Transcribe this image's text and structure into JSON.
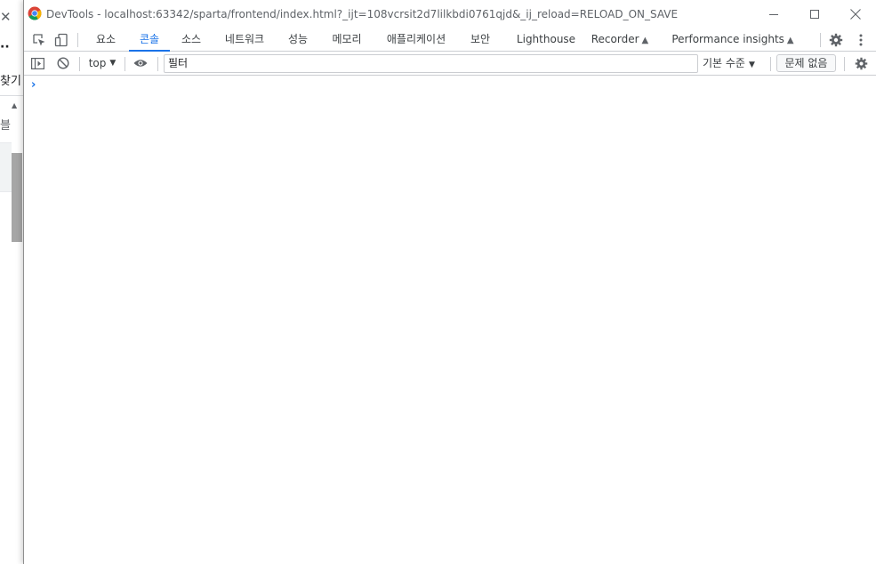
{
  "background_window": {
    "close_glyph": "✕",
    "dots": "··",
    "text_1": "찾기",
    "text_2": "블"
  },
  "window": {
    "title": "DevTools - localhost:63342/sparta/frontend/index.html?_ijt=108vcrsit2d7lilkbdi0761qjd&_ij_reload=RELOAD_ON_SAVE",
    "app_icon": "chrome-icon"
  },
  "tabs": [
    {
      "label": "요소",
      "active": false
    },
    {
      "label": "콘솔",
      "active": true
    },
    {
      "label": "소스",
      "active": false
    },
    {
      "label": "네트워크",
      "active": false
    },
    {
      "label": "성능",
      "active": false
    },
    {
      "label": "메모리",
      "active": false
    },
    {
      "label": "애플리케이션",
      "active": false
    },
    {
      "label": "보안",
      "active": false
    },
    {
      "label": "Lighthouse",
      "active": false
    },
    {
      "label": "Recorder",
      "active": false,
      "experimental": true
    },
    {
      "label": "Performance insights",
      "active": false,
      "experimental": true
    }
  ],
  "console_toolbar": {
    "context": "top",
    "filter_placeholder": "필터",
    "levels": "기본 수준",
    "issues": "문제 없음"
  },
  "console": {
    "prompt_glyph": "›"
  },
  "colors": {
    "accent": "#1a73e8",
    "border": "#cbcdd1",
    "text": "#3c4043"
  }
}
